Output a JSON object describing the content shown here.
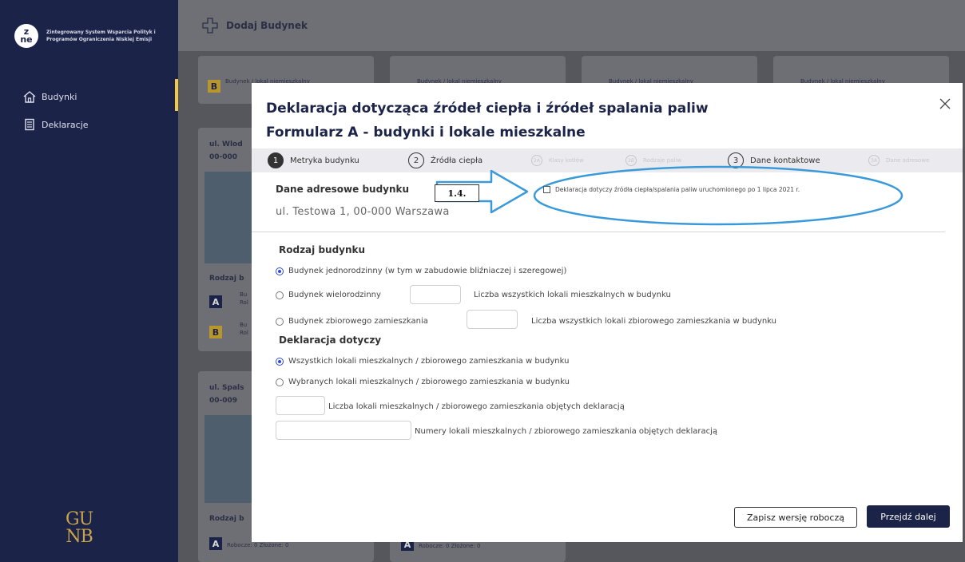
{
  "sidebar": {
    "brand_logo_line1": "z",
    "brand_logo_line2": "ne",
    "brand_text": "Zintegrowany System Wsparcia Polityk i Programów Ograniczenia Niskiej Emisji",
    "items": [
      {
        "label": "Budynki",
        "icon": "home-icon",
        "active": true
      },
      {
        "label": "Deklaracje",
        "icon": "document-icon",
        "active": false
      }
    ],
    "footer_logo_line1": "GU",
    "footer_logo_line2": "NB"
  },
  "topbar": {
    "add_label": "Dodaj Budynek",
    "add_icon": "plus-icon"
  },
  "background_cards": {
    "street_1": "ul. Wlod",
    "postal_1": "00-000",
    "street_2": "ul. Spals",
    "postal_2": "00-009",
    "type_label": "Rodzaj b",
    "badge_a": "A",
    "badge_b": "B",
    "row_prefix": "Bu",
    "row_sub": "Rol",
    "building_row": "Budynek / lokal niemieszkalny",
    "counts": "Robocze: 0   Złożone: 0"
  },
  "modal": {
    "title": "Deklaracja dotycząca źródeł ciepła i źródeł spalania paliw",
    "subtitle": "Formularz A - budynki i lokale mieszkalne",
    "close_icon": "close-icon",
    "steps": [
      {
        "num": "1",
        "label": "Metryka budynku",
        "state": "active"
      },
      {
        "num": "2",
        "label": "Źródła ciepła",
        "state": "normal"
      },
      {
        "num": "2A",
        "label": "Klasy kotłów",
        "state": "muted"
      },
      {
        "num": "2B",
        "label": "Rodzaje paliw",
        "state": "muted"
      },
      {
        "num": "3",
        "label": "Dane kontaktowe",
        "state": "normal"
      },
      {
        "num": "3A",
        "label": "Dane adresowe",
        "state": "muted"
      }
    ],
    "address_label": "Dane adresowe budynku",
    "address_value": "ul. Testowa 1, 00-000 Warszawa",
    "annotation_label": "1.4.",
    "after_july_checkbox": "Deklaracja dotyczy źródła ciepła/spalania paliw uruchomionego po 1 lipca 2021 r.",
    "building_type_heading": "Rodzaj budynku",
    "building_types": [
      {
        "label": "Budynek jednorodzinny (w tym w zabudowie bliźniaczej i szeregowej)",
        "selected": true
      },
      {
        "label": "Budynek wielorodzinny",
        "selected": false,
        "count_label": "Liczba wszystkich lokali mieszkalnych w budynku"
      },
      {
        "label": "Budynek zbiorowego zamieszkania",
        "selected": false,
        "count_label": "Liczba wszystkich lokali zbiorowego zamieszkania w budynku"
      }
    ],
    "scope_heading": "Deklaracja dotyczy",
    "scope_options": [
      {
        "label": "Wszystkich lokali mieszkalnych / zbiorowego zamieszkania w budynku",
        "selected": true
      },
      {
        "label": "Wybranych lokali mieszkalnych / zbiorowego zamieszkania w budynku",
        "selected": false
      }
    ],
    "units_count_label": "Liczba lokali mieszkalnych / zbiorowego zamieszkania objętych deklaracją",
    "units_numbers_label": "Numery lokali mieszkalnych / zbiorowego zamieszkania objętych deklaracją",
    "save_draft_label": "Zapisz wersję roboczą",
    "next_label": "Przejdź dalej"
  },
  "colors": {
    "sidebar_bg": "#1b2348",
    "accent_yellow": "#f2c94c",
    "primary_navy": "#1b2348",
    "radio_blue": "#2f4bd0",
    "annotation_blue": "#3a9ad9"
  }
}
